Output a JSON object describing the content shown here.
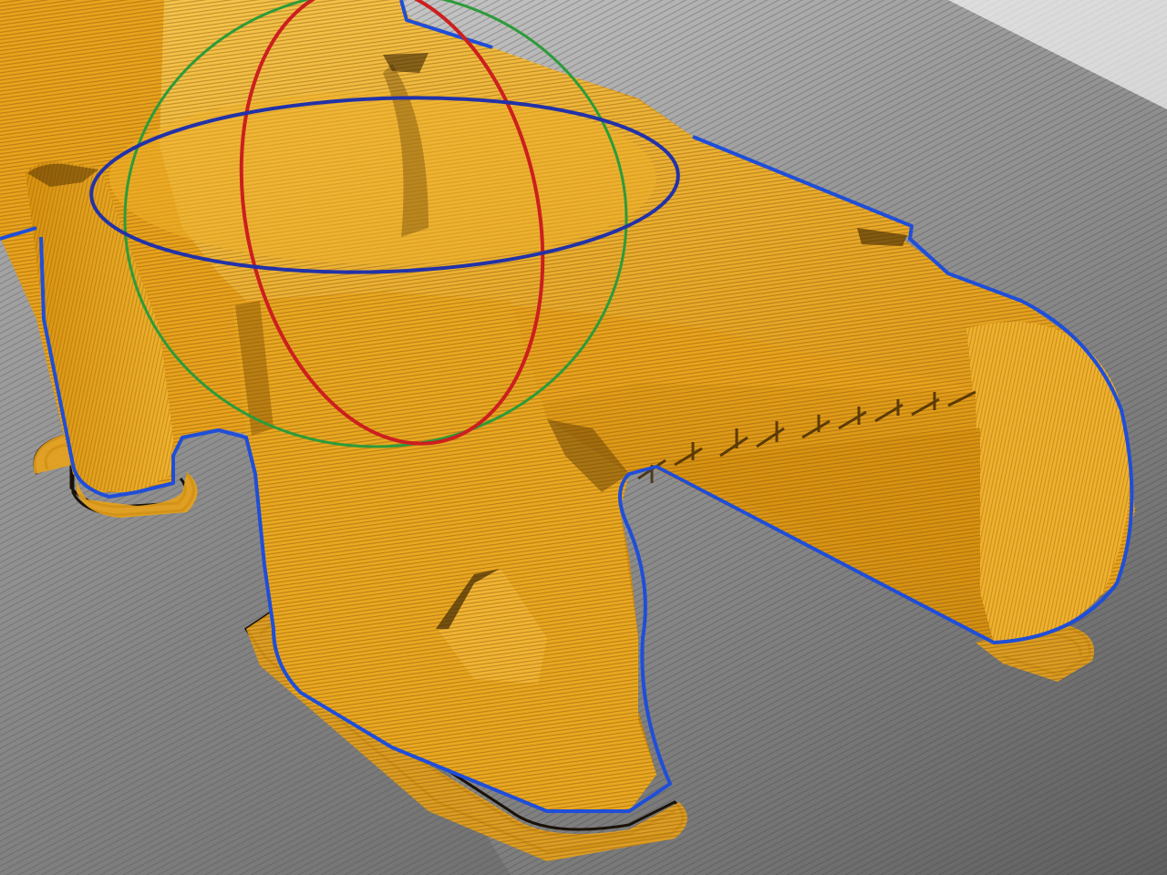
{
  "viewport": {
    "colors": {
      "bed_light": "#d4d4d4",
      "bed_dark": "#6f6f6f",
      "grid_line": "#4a4a4a",
      "print_base": "#e8a21a",
      "print_light": "#f3bb3c",
      "print_shade": "#b8780c",
      "print_deep": "#6d4405",
      "skirt_line": "#1a1208",
      "outline_blue": "#1f4ed8",
      "gizmo_x": "#cc1f1f",
      "gizmo_y": "#2d9b3a",
      "gizmo_z": "#2232a8"
    },
    "layer_texture": "horizontal-layer-lines",
    "model": "printed-part-preview",
    "gizmo": "rotate-gizmo"
  }
}
